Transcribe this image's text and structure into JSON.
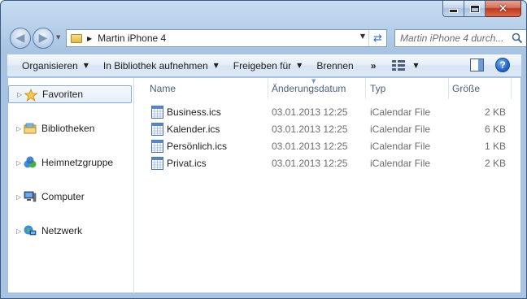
{
  "window": {
    "caption_buttons": {
      "minimize": "minimize",
      "maximize": "maximize",
      "close": "✕"
    }
  },
  "address": {
    "path": "Martin iPhone 4"
  },
  "search": {
    "placeholder": "Martin iPhone 4 durch..."
  },
  "toolbar": {
    "organize": "Organisieren",
    "include_library": "In Bibliothek aufnehmen",
    "share": "Freigeben für",
    "burn": "Brennen",
    "more": "»"
  },
  "sidebar": {
    "items": [
      {
        "label": "Favoriten",
        "icon": "star-icon",
        "selected": true
      },
      {
        "label": "Bibliotheken",
        "icon": "libraries-icon",
        "selected": false
      },
      {
        "label": "Heimnetzgruppe",
        "icon": "homegroup-icon",
        "selected": false
      },
      {
        "label": "Computer",
        "icon": "computer-icon",
        "selected": false
      },
      {
        "label": "Netzwerk",
        "icon": "network-icon",
        "selected": false
      }
    ]
  },
  "columns": {
    "name": "Name",
    "date": "Änderungsdatum",
    "type": "Typ",
    "size": "Größe"
  },
  "files": [
    {
      "name": "Business.ics",
      "date": "03.01.2013 12:25",
      "type": "iCalendar File",
      "size": "2 KB"
    },
    {
      "name": "Kalender.ics",
      "date": "03.01.2013 12:25",
      "type": "iCalendar File",
      "size": "6 KB"
    },
    {
      "name": "Persönlich.ics",
      "date": "03.01.2013 12:25",
      "type": "iCalendar File",
      "size": "1 KB"
    },
    {
      "name": "Privat.ics",
      "date": "03.01.2013 12:25",
      "type": "iCalendar File",
      "size": "2 KB"
    }
  ],
  "colors": {
    "title_bar": "#b9d1ea",
    "selection_border": "#84acdd",
    "column_header_text": "#4c607a",
    "secondary_text": "#6d6d6d",
    "close_button": "#c0391f"
  }
}
